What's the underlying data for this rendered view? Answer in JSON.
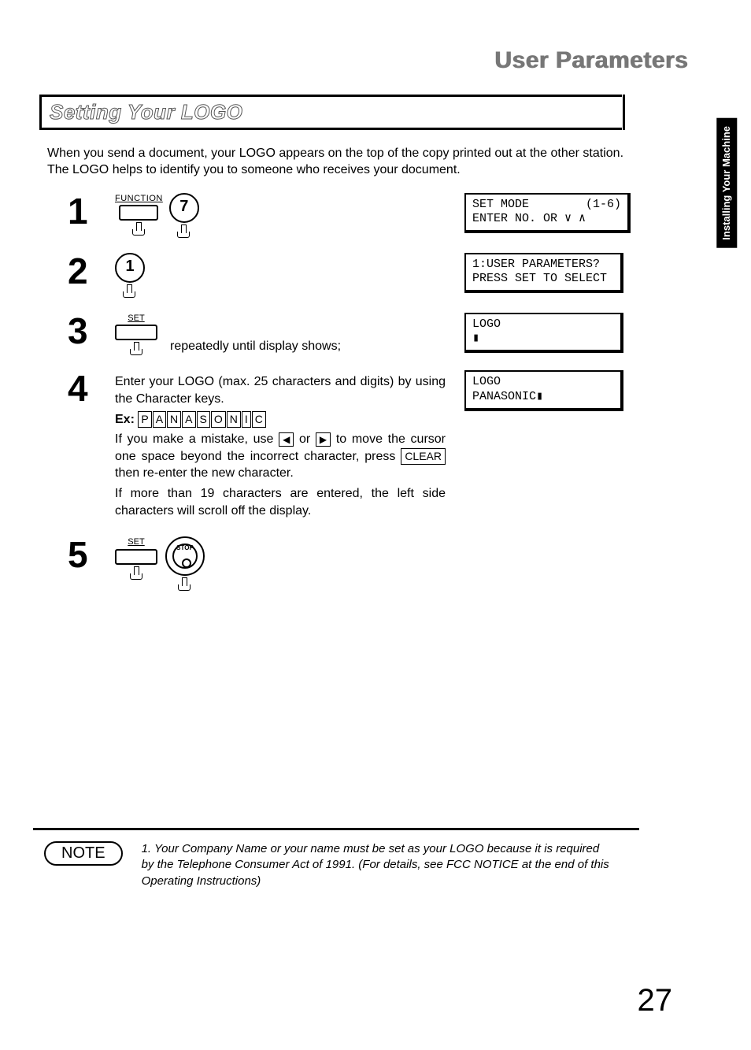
{
  "header": "User Parameters",
  "section_title": "Setting Your LOGO",
  "intro": "When you send a document, your LOGO appears on the top of the copy printed out at the other station. The LOGO helps to identify you to someone who receives your document.",
  "side_tab": "Installing Your\nMachine",
  "steps": {
    "s1": {
      "num": "1",
      "function_label": "FUNCTION",
      "key_digit": "7",
      "lcd": "SET MODE        (1-6)\nENTER NO. OR ∨ ∧"
    },
    "s2": {
      "num": "2",
      "key_digit": "1",
      "lcd": "1:USER PARAMETERS?\nPRESS SET TO SELECT"
    },
    "s3": {
      "num": "3",
      "set_label": "SET",
      "tail": "repeatedly until display shows;",
      "lcd": "LOGO\n▮"
    },
    "s4": {
      "num": "4",
      "p1": "Enter your LOGO (max. 25 characters and digits) by using the Character keys.",
      "ex_label": "Ex:",
      "ex_chars": [
        "P",
        "A",
        "N",
        "A",
        "S",
        "O",
        "N",
        "I",
        "C"
      ],
      "p2a": "If you make a mistake, use ",
      "p2b": " or ",
      "p2c": " to move the cursor one space beyond the incorrect character, press ",
      "clear": "CLEAR",
      "p2d": " then re-enter the new character.",
      "p3": "If more than 19 characters are entered, the left side characters will scroll off the display.",
      "lcd": "LOGO\nPANASONIC▮"
    },
    "s5": {
      "num": "5",
      "set_label": "SET",
      "stop_label": "STOP"
    }
  },
  "note": {
    "label": "NOTE",
    "text": "1. Your Company Name or your name must be set as your LOGO because it is required by the Telephone Consumer Act of 1991. (For details, see FCC NOTICE at the end of this Operating Instructions)"
  },
  "page_number": "27"
}
